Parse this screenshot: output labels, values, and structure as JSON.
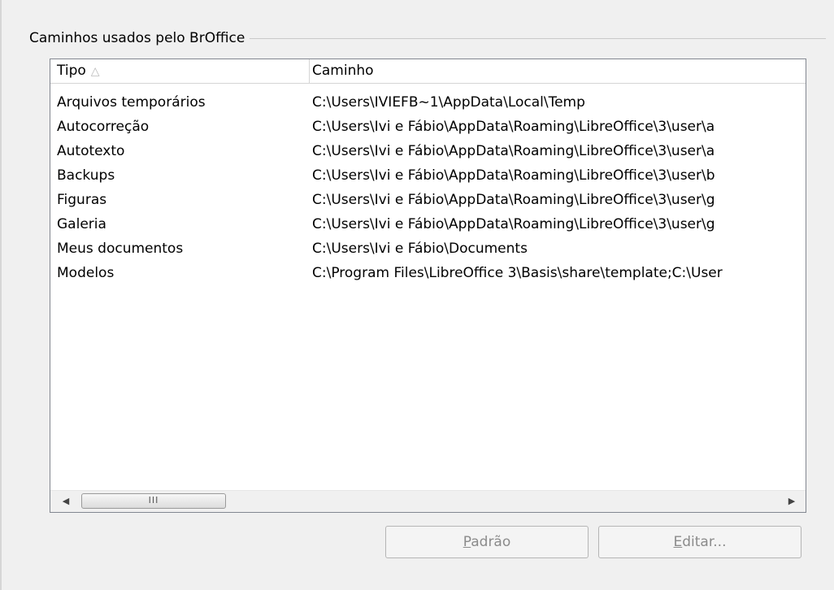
{
  "group": {
    "title": "Caminhos usados pelo BrOffice"
  },
  "table": {
    "columns": [
      {
        "label": "Tipo",
        "sort_indicator": "△"
      },
      {
        "label": "Caminho"
      }
    ],
    "rows": [
      {
        "tipo": "Arquivos temporários",
        "caminho": "C:\\Users\\IVIEFB~1\\AppData\\Local\\Temp"
      },
      {
        "tipo": "Autocorreção",
        "caminho": "C:\\Users\\Ivi e Fábio\\AppData\\Roaming\\LibreOffice\\3\\user\\a"
      },
      {
        "tipo": "Autotexto",
        "caminho": "C:\\Users\\Ivi e Fábio\\AppData\\Roaming\\LibreOffice\\3\\user\\a"
      },
      {
        "tipo": "Backups",
        "caminho": "C:\\Users\\Ivi e Fábio\\AppData\\Roaming\\LibreOffice\\3\\user\\b"
      },
      {
        "tipo": "Figuras",
        "caminho": "C:\\Users\\Ivi e Fábio\\AppData\\Roaming\\LibreOffice\\3\\user\\g"
      },
      {
        "tipo": "Galeria",
        "caminho": "C:\\Users\\Ivi e Fábio\\AppData\\Roaming\\LibreOffice\\3\\user\\g"
      },
      {
        "tipo": "Meus documentos",
        "caminho": "C:\\Users\\Ivi e Fábio\\Documents"
      },
      {
        "tipo": "Modelos",
        "caminho": "C:\\Program Files\\LibreOffice 3\\Basis\\share\\template;C:\\User"
      }
    ]
  },
  "scrollbar": {
    "left_icon": "arrow-left-icon",
    "right_icon": "arrow-right-icon",
    "thumb_grip": "III"
  },
  "buttons": {
    "padrao": {
      "accel": "P",
      "rest": "adrão"
    },
    "editar": {
      "accel": "E",
      "rest": "ditar..."
    }
  }
}
